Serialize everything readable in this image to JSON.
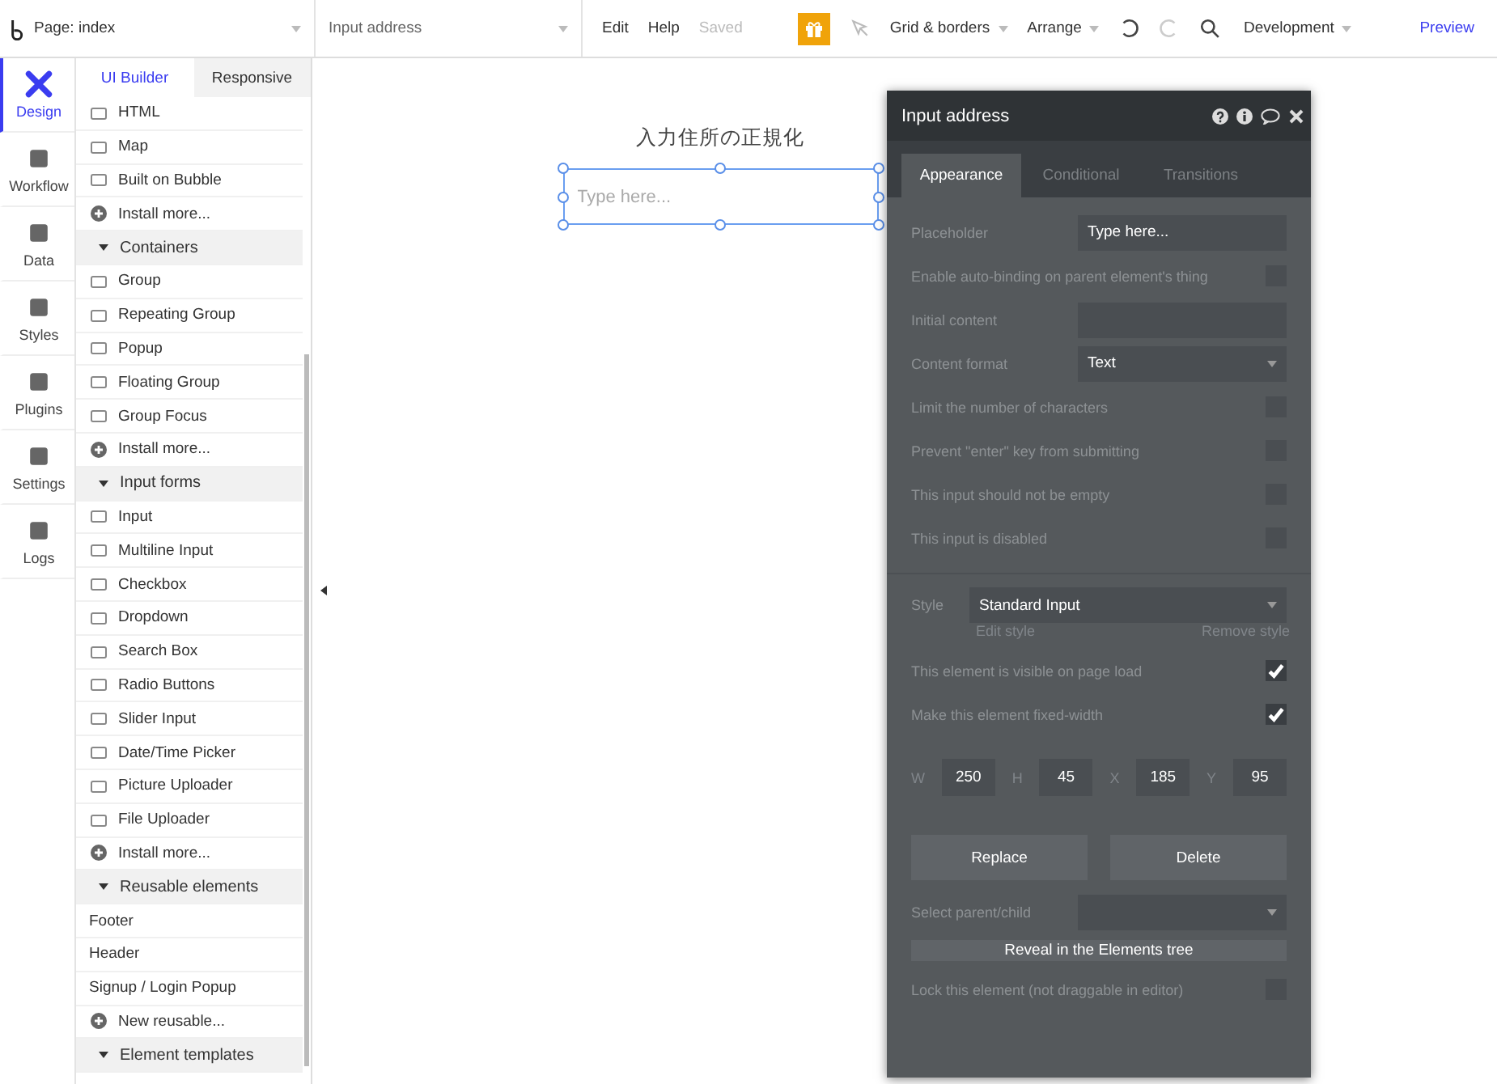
{
  "topbar": {
    "page_selector": "Page: index",
    "element_selector": "Input address",
    "menus": [
      "Edit",
      "Help"
    ],
    "status": "Saved",
    "tools": [
      "Grid & borders",
      "Arrange"
    ],
    "environment": "Development",
    "preview": "Preview"
  },
  "nav": [
    {
      "label": "Design",
      "selected": true
    },
    {
      "label": "Workflow",
      "selected": false
    },
    {
      "label": "Data",
      "selected": false
    },
    {
      "label": "Styles",
      "selected": false
    },
    {
      "label": "Plugins",
      "selected": false
    },
    {
      "label": "Settings",
      "selected": false
    },
    {
      "label": "Logs",
      "selected": false
    }
  ],
  "palette": {
    "tabs": [
      {
        "label": "UI Builder",
        "selected": true
      },
      {
        "label": "Responsive",
        "selected": false
      }
    ],
    "items": [
      {
        "kind": "element",
        "label": "HTML"
      },
      {
        "kind": "element",
        "label": "Map"
      },
      {
        "kind": "element",
        "label": "Built on Bubble"
      },
      {
        "kind": "install",
        "label": "Install more..."
      },
      {
        "kind": "section",
        "label": "Containers"
      },
      {
        "kind": "element",
        "label": "Group"
      },
      {
        "kind": "element",
        "label": "Repeating Group"
      },
      {
        "kind": "element",
        "label": "Popup"
      },
      {
        "kind": "element",
        "label": "Floating Group"
      },
      {
        "kind": "element",
        "label": "Group Focus"
      },
      {
        "kind": "install",
        "label": "Install more..."
      },
      {
        "kind": "section",
        "label": "Input forms"
      },
      {
        "kind": "element",
        "label": "Input"
      },
      {
        "kind": "element",
        "label": "Multiline Input"
      },
      {
        "kind": "element",
        "label": "Checkbox"
      },
      {
        "kind": "element",
        "label": "Dropdown"
      },
      {
        "kind": "element",
        "label": "Search Box"
      },
      {
        "kind": "element",
        "label": "Radio Buttons"
      },
      {
        "kind": "element",
        "label": "Slider Input"
      },
      {
        "kind": "element",
        "label": "Date/Time Picker"
      },
      {
        "kind": "element",
        "label": "Picture Uploader"
      },
      {
        "kind": "element",
        "label": "File Uploader"
      },
      {
        "kind": "install",
        "label": "Install more..."
      },
      {
        "kind": "section",
        "label": "Reusable elements"
      },
      {
        "kind": "plain",
        "label": "Footer"
      },
      {
        "kind": "plain",
        "label": "Header"
      },
      {
        "kind": "plain",
        "label": "Signup / Login Popup"
      },
      {
        "kind": "install",
        "label": "New reusable..."
      },
      {
        "kind": "section",
        "label": "Element templates"
      }
    ]
  },
  "canvas": {
    "heading": "入力住所の正規化",
    "input": {
      "placeholder": "Type here...",
      "selected": true
    }
  },
  "panel": {
    "title": "Input address",
    "tabs": [
      {
        "label": "Appearance",
        "selected": true
      },
      {
        "label": "Conditional",
        "selected": false
      },
      {
        "label": "Transitions",
        "selected": false
      }
    ],
    "rows": [
      {
        "kind": "field",
        "label": "Placeholder",
        "value": "Type here..."
      },
      {
        "kind": "checkbox",
        "label": "Enable auto-binding on parent element's thing",
        "checked": false
      },
      {
        "kind": "field",
        "label": "Initial content"
      },
      {
        "kind": "dropdown",
        "label": "Content format",
        "value": "Text"
      },
      {
        "kind": "checkbox",
        "label": "Limit the number of characters",
        "checked": false
      },
      {
        "kind": "checkbox",
        "label": "Prevent \"enter\" key from submitting",
        "checked": false
      },
      {
        "kind": "checkbox",
        "label": "This input should not be empty",
        "checked": false
      },
      {
        "kind": "checkbox",
        "label": "This input is disabled",
        "checked": false
      }
    ],
    "style": {
      "label": "Style",
      "value": "Standard Input",
      "edit": "Edit style",
      "remove": "Remove style"
    },
    "rows2": [
      {
        "kind": "checkbox",
        "label": "This element is visible on page load",
        "checked": true
      },
      {
        "kind": "checkbox",
        "label": "Make this element fixed-width",
        "checked": true
      }
    ],
    "dims": [
      {
        "label": "W",
        "value": "250"
      },
      {
        "label": "H",
        "value": "45"
      },
      {
        "label": "X",
        "value": "185"
      },
      {
        "label": "Y",
        "value": "95"
      }
    ],
    "buttons": [
      "Replace",
      "Delete"
    ],
    "parent_select": {
      "label": "Select parent/child"
    },
    "reveal": "Reveal in the Elements tree",
    "lock": {
      "label": "Lock this element (not draggable in editor)",
      "checked": false
    }
  }
}
